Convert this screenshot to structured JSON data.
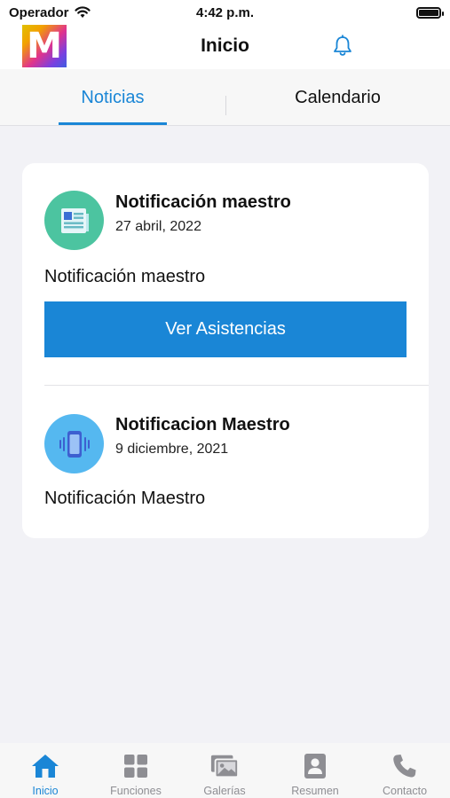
{
  "status_bar": {
    "carrier": "Operador",
    "time": "4:42 p.m."
  },
  "nav": {
    "logo_letter": "M",
    "title": "Inicio"
  },
  "tabs": [
    {
      "label": "Noticias",
      "active": true
    },
    {
      "label": "Calendario",
      "active": false
    }
  ],
  "news": [
    {
      "title": "Notificación maestro",
      "date": "27 abril, 2022",
      "body": "Notificación maestro",
      "icon": "newspaper-icon",
      "button_label": "Ver Asistencias"
    },
    {
      "title": "Notificacion Maestro",
      "date": "9 diciembre, 2021",
      "body": "Notificación Maestro",
      "icon": "vibrating-phone-icon"
    }
  ],
  "tab_bar": [
    {
      "label": "Inicio",
      "icon": "home-icon",
      "active": true
    },
    {
      "label": "Funciones",
      "icon": "grid-icon",
      "active": false
    },
    {
      "label": "Galerías",
      "icon": "gallery-icon",
      "active": false
    },
    {
      "label": "Resumen",
      "icon": "contact-card-icon",
      "active": false
    },
    {
      "label": "Contacto",
      "icon": "phone-icon",
      "active": false
    }
  ],
  "colors": {
    "accent": "#1a86d6",
    "inactive": "#8e8e93",
    "background": "#f2f2f6",
    "icon_green": "#4cc4a0",
    "icon_blue": "#55b8f0"
  }
}
